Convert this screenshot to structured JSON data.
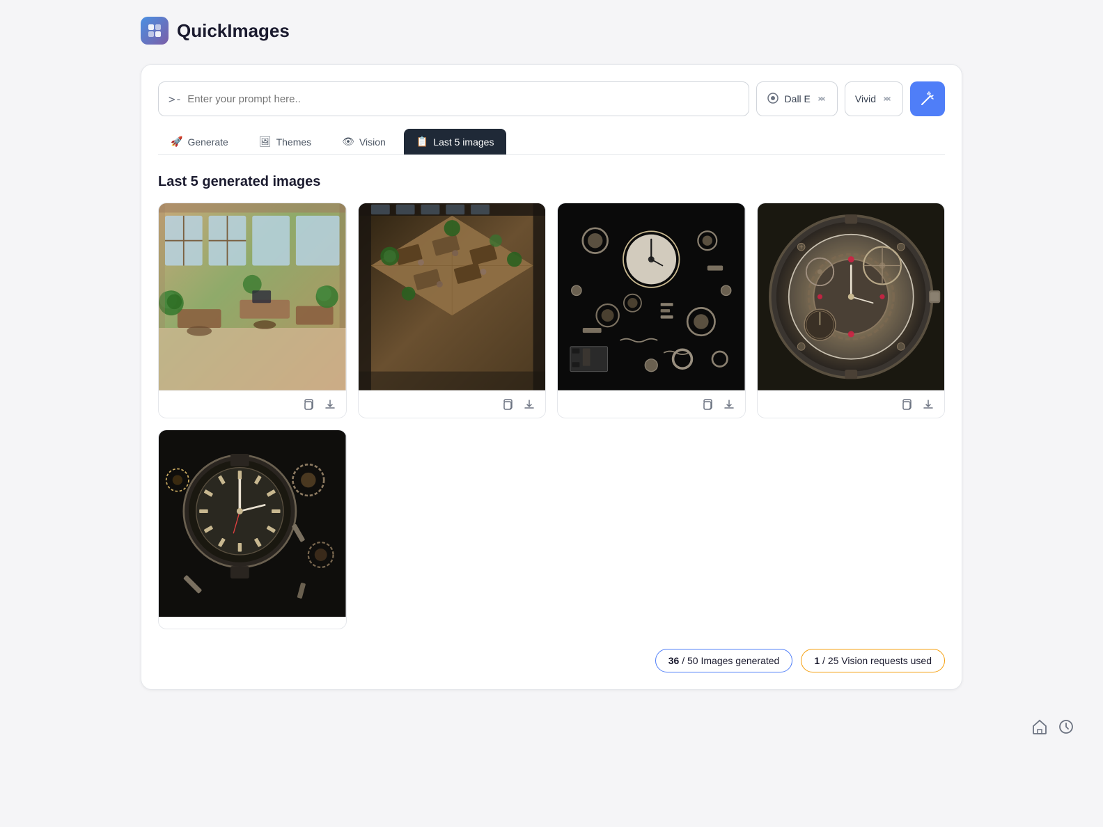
{
  "app": {
    "title": "QuickImages",
    "logo_icon": "🎨"
  },
  "prompt": {
    "prefix": ">-",
    "placeholder": "Enter your prompt here.."
  },
  "controls": {
    "model_label": "Dall E",
    "style_label": "Vivid",
    "magic_icon": "✦"
  },
  "tabs": [
    {
      "id": "generate",
      "label": "Generate",
      "icon": "🚀",
      "active": false
    },
    {
      "id": "themes",
      "label": "Themes",
      "icon": "🖼",
      "active": false
    },
    {
      "id": "vision",
      "label": "Vision",
      "icon": "👁",
      "active": false
    },
    {
      "id": "last5",
      "label": "Last 5 images",
      "icon": "📋",
      "active": true
    }
  ],
  "section": {
    "title": "Last 5 generated images"
  },
  "images": [
    {
      "id": "img1",
      "alt": "Office interior with plants"
    },
    {
      "id": "img2",
      "alt": "Aerial office view with plants"
    },
    {
      "id": "img3",
      "alt": "Mechanical watch parts exploded"
    },
    {
      "id": "img4",
      "alt": "Watch mechanism close-up"
    },
    {
      "id": "img5",
      "alt": "Watch with gears on dark background"
    }
  ],
  "action_icons": {
    "copy": "⧉",
    "download": "⬇"
  },
  "stats": {
    "images_used": "36",
    "images_total": "50",
    "images_label": "Images generated",
    "vision_used": "1",
    "vision_total": "25",
    "vision_label": "Vision requests used"
  },
  "bottom_nav": {
    "home_icon": "⌂",
    "history_icon": "🕐"
  }
}
